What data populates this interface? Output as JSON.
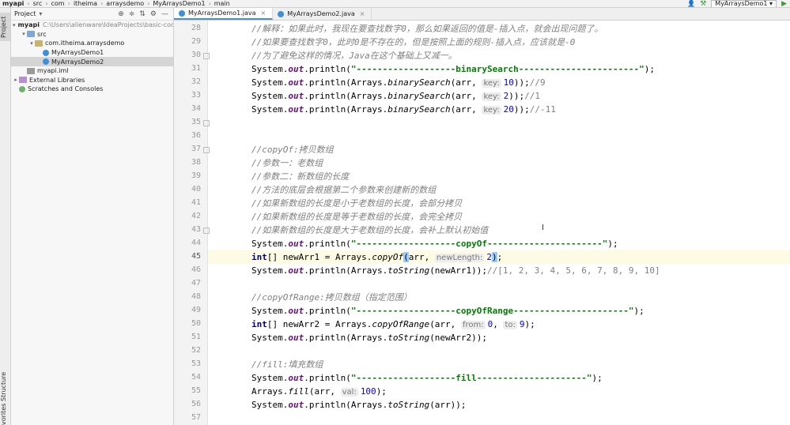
{
  "breadcrumbs": [
    "myapi",
    "src",
    "com",
    "itheima",
    "arraysdemo",
    "MyArraysDemo1",
    "main"
  ],
  "run_config": "MyArraysDemo1",
  "toolstrip": {
    "project_tab": "Project",
    "structure_tab": "Structure",
    "favorites_tab": "vorites"
  },
  "project_panel": {
    "title": "Project",
    "tree": [
      {
        "label": "myapi",
        "path": "C:\\Users\\alienware\\IdeaProjects\\basic-code\\m",
        "depth": 0,
        "expanded": true,
        "icon": "folder-icon",
        "bold": true
      },
      {
        "label": "src",
        "depth": 1,
        "expanded": true,
        "icon": "folder-icon"
      },
      {
        "label": "com.itheima.arraysdemo",
        "depth": 2,
        "expanded": true,
        "icon": "package-icon"
      },
      {
        "label": "MyArraysDemo1",
        "depth": 3,
        "icon": "java-class-icon"
      },
      {
        "label": "MyArraysDemo2",
        "depth": 3,
        "icon": "java-class-icon",
        "selected": true
      },
      {
        "label": "myapi.iml",
        "depth": 1,
        "icon": "iml-file-icon"
      },
      {
        "label": "External Libraries",
        "depth": 0,
        "expanded": false,
        "icon": "library-icon"
      },
      {
        "label": "Scratches and Consoles",
        "depth": 0,
        "icon": "scratch-icon"
      }
    ]
  },
  "editor_tabs": [
    {
      "label": "MyArraysDemo1.java",
      "active": true
    },
    {
      "label": "MyArraysDemo2.java",
      "active": false
    }
  ],
  "code_lines": [
    {
      "n": 28,
      "tokens": [
        {
          "t": "//解释：如果此时，我现在要查找数字0，那么如果返回的值是-插入点，就会出现问题了。",
          "c": "cm"
        }
      ]
    },
    {
      "n": 29,
      "tokens": [
        {
          "t": "//如果要查找数字0，此时0是不存在的，但是按照上面的规则-插入点，应该就是-0",
          "c": "cm"
        }
      ]
    },
    {
      "n": 30,
      "fold": true,
      "tokens": [
        {
          "t": "//为了避免这样的情况，Java在这个基础上又减一。",
          "c": "cm"
        }
      ]
    },
    {
      "n": 31,
      "tokens": [
        {
          "t": "System."
        },
        {
          "t": "out",
          "c": "fld"
        },
        {
          "t": ".println("
        },
        {
          "t": "\"-------------------binarySearch-----------------------\"",
          "c": "str"
        },
        {
          "t": ");"
        }
      ]
    },
    {
      "n": 32,
      "tokens": [
        {
          "t": "System."
        },
        {
          "t": "out",
          "c": "fld"
        },
        {
          "t": ".println(Arrays."
        },
        {
          "t": "binarySearch",
          "c": "stc"
        },
        {
          "t": "(arr, "
        },
        {
          "t": "key:",
          "c": "hint"
        },
        {
          "t": "10",
          "c": "num"
        },
        {
          "t": "));"
        },
        {
          "t": "//9",
          "c": "cmn"
        }
      ]
    },
    {
      "n": 33,
      "tokens": [
        {
          "t": "System."
        },
        {
          "t": "out",
          "c": "fld"
        },
        {
          "t": ".println(Arrays."
        },
        {
          "t": "binarySearch",
          "c": "stc"
        },
        {
          "t": "(arr, "
        },
        {
          "t": "key:",
          "c": "hint"
        },
        {
          "t": "2",
          "c": "num"
        },
        {
          "t": "));"
        },
        {
          "t": "//1",
          "c": "cmn"
        }
      ]
    },
    {
      "n": 34,
      "tokens": [
        {
          "t": "System."
        },
        {
          "t": "out",
          "c": "fld"
        },
        {
          "t": ".println(Arrays."
        },
        {
          "t": "binarySearch",
          "c": "stc"
        },
        {
          "t": "(arr, "
        },
        {
          "t": "key:",
          "c": "hint"
        },
        {
          "t": "20",
          "c": "num"
        },
        {
          "t": "));"
        },
        {
          "t": "//-11",
          "c": "cmn"
        }
      ]
    },
    {
      "n": 35,
      "fold": true,
      "tokens": []
    },
    {
      "n": 36,
      "tokens": []
    },
    {
      "n": 37,
      "fold": true,
      "tokens": [
        {
          "t": "//copyOf:拷贝数组",
          "c": "cm"
        }
      ]
    },
    {
      "n": 38,
      "tokens": [
        {
          "t": "//参数一：老数组",
          "c": "cm"
        }
      ]
    },
    {
      "n": 39,
      "tokens": [
        {
          "t": "//参数二：新数组的长度",
          "c": "cm"
        }
      ]
    },
    {
      "n": 40,
      "tokens": [
        {
          "t": "//方法的底层会根据第二个参数来创建新的数组",
          "c": "cm"
        }
      ]
    },
    {
      "n": 41,
      "tokens": [
        {
          "t": "//如果新数组的长度是小于老数组的长度，会部分拷贝",
          "c": "cm"
        }
      ]
    },
    {
      "n": 42,
      "tokens": [
        {
          "t": "//如果新数组的长度是等于老数组的长度，会完全拷贝",
          "c": "cm"
        }
      ]
    },
    {
      "n": 43,
      "fold": true,
      "tokens": [
        {
          "t": "//如果新数组的长度是大于老数组的长度，会补上默认初始值",
          "c": "cm"
        }
      ]
    },
    {
      "n": 44,
      "tokens": [
        {
          "t": "System."
        },
        {
          "t": "out",
          "c": "fld"
        },
        {
          "t": ".println("
        },
        {
          "t": "\"-------------------copyOf----------------------\"",
          "c": "str"
        },
        {
          "t": ");"
        }
      ]
    },
    {
      "n": 45,
      "current": true,
      "tokens": [
        {
          "t": "int",
          "c": "kw"
        },
        {
          "t": "[] newArr1 = Arrays."
        },
        {
          "t": "copyOf",
          "c": "stc"
        },
        {
          "t": "(",
          "c": "brace-hl"
        },
        {
          "t": "arr, "
        },
        {
          "t": "newLength:",
          "c": "hint"
        },
        {
          "t": "2",
          "c": "num"
        },
        {
          "t": ")",
          "c": "brace-hl"
        },
        {
          "t": ";"
        }
      ]
    },
    {
      "n": 46,
      "tokens": [
        {
          "t": "System."
        },
        {
          "t": "out",
          "c": "fld"
        },
        {
          "t": ".println(Arrays."
        },
        {
          "t": "toString",
          "c": "stc"
        },
        {
          "t": "(newArr1));"
        },
        {
          "t": "//[1, 2, 3, 4, 5, 6, 7, 8, 9, 10]",
          "c": "cmn"
        }
      ]
    },
    {
      "n": 47,
      "tokens": []
    },
    {
      "n": 48,
      "tokens": [
        {
          "t": "//copyOfRange:拷贝数组（指定范围）",
          "c": "cm"
        }
      ]
    },
    {
      "n": 49,
      "tokens": [
        {
          "t": "System."
        },
        {
          "t": "out",
          "c": "fld"
        },
        {
          "t": ".println("
        },
        {
          "t": "\"-------------------copyOfRange----------------------\"",
          "c": "str"
        },
        {
          "t": ");"
        }
      ]
    },
    {
      "n": 50,
      "tokens": [
        {
          "t": "int",
          "c": "kw"
        },
        {
          "t": "[] newArr2 = Arrays."
        },
        {
          "t": "copyOfRange",
          "c": "stc"
        },
        {
          "t": "(arr, "
        },
        {
          "t": "from:",
          "c": "hint"
        },
        {
          "t": "0",
          "c": "num"
        },
        {
          "t": ", "
        },
        {
          "t": "to:",
          "c": "hint"
        },
        {
          "t": "9",
          "c": "num"
        },
        {
          "t": ");"
        }
      ]
    },
    {
      "n": 51,
      "tokens": [
        {
          "t": "System."
        },
        {
          "t": "out",
          "c": "fld"
        },
        {
          "t": ".println(Arrays."
        },
        {
          "t": "toString",
          "c": "stc"
        },
        {
          "t": "(newArr2));"
        }
      ]
    },
    {
      "n": 52,
      "tokens": []
    },
    {
      "n": 53,
      "tokens": [
        {
          "t": "//fill:填充数组",
          "c": "cm"
        }
      ]
    },
    {
      "n": 54,
      "tokens": [
        {
          "t": "System."
        },
        {
          "t": "out",
          "c": "fld"
        },
        {
          "t": ".println("
        },
        {
          "t": "\"-------------------fill---------------------\"",
          "c": "str"
        },
        {
          "t": ");"
        }
      ]
    },
    {
      "n": 55,
      "tokens": [
        {
          "t": "Arrays."
        },
        {
          "t": "fill",
          "c": "stc"
        },
        {
          "t": "(arr, "
        },
        {
          "t": "val:",
          "c": "hint"
        },
        {
          "t": "100",
          "c": "num"
        },
        {
          "t": ");"
        }
      ]
    },
    {
      "n": 56,
      "tokens": [
        {
          "t": "System."
        },
        {
          "t": "out",
          "c": "fld"
        },
        {
          "t": ".println(Arrays."
        },
        {
          "t": "toString",
          "c": "stc"
        },
        {
          "t": "(arr));"
        }
      ]
    },
    {
      "n": 57,
      "tokens": []
    }
  ]
}
